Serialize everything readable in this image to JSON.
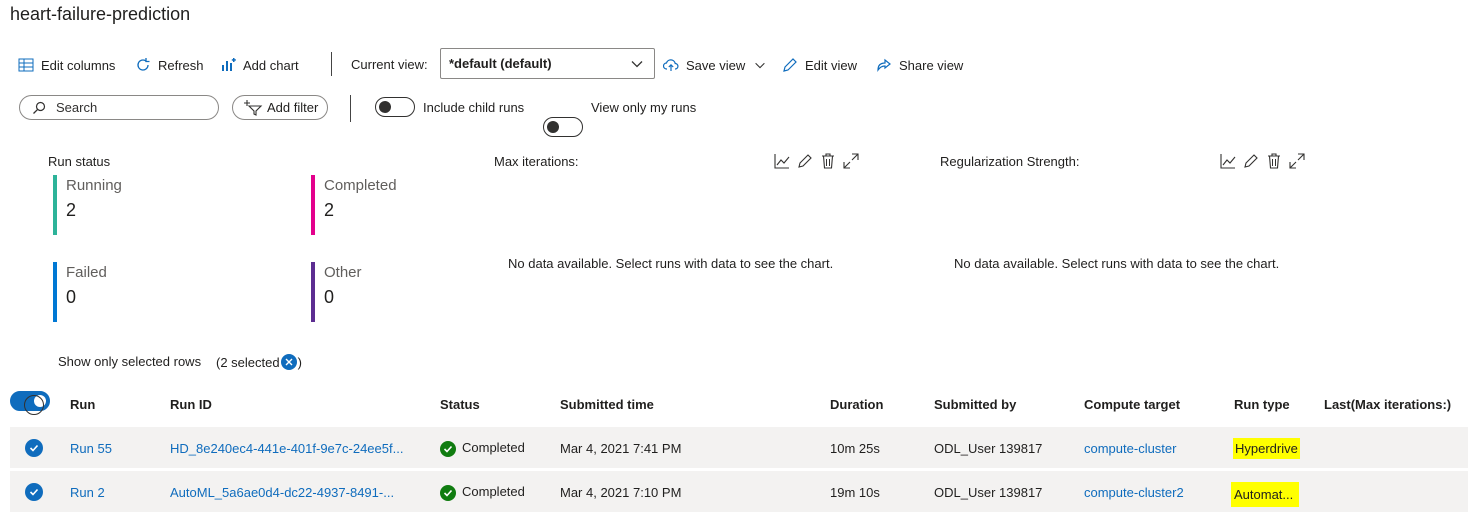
{
  "page": {
    "title": "heart-failure-prediction"
  },
  "toolbar": {
    "edit_columns": "Edit columns",
    "refresh": "Refresh",
    "add_chart": "Add chart",
    "current_view_label": "Current view:",
    "current_view_value": "*default (default)",
    "save_view": "Save view",
    "edit_view": "Edit view",
    "share_view": "Share view"
  },
  "filters": {
    "search_placeholder": "Search",
    "add_filter": "Add filter",
    "include_child_runs": "Include child runs",
    "view_only_my_runs": "View only my runs"
  },
  "run_status": {
    "title": "Run status",
    "tiles": [
      {
        "label": "Running",
        "count": "2",
        "color": "#2db399"
      },
      {
        "label": "Completed",
        "count": "2",
        "color": "#e3008c"
      },
      {
        "label": "Failed",
        "count": "0",
        "color": "#0078d4"
      },
      {
        "label": "Other",
        "count": "0",
        "color": "#5c2d91"
      }
    ]
  },
  "charts": [
    {
      "title": "Max iterations:",
      "message": "No data available. Select runs with data to see the chart."
    },
    {
      "title": "Regularization Strength:",
      "message": "No data available. Select runs with data to see the chart."
    }
  ],
  "selection": {
    "label": "Show only selected rows",
    "count_text": "(2 selected",
    "close_paren": ")"
  },
  "table": {
    "headers": [
      "Run",
      "Run ID",
      "Status",
      "Submitted time",
      "Duration",
      "Submitted by",
      "Compute target",
      "Run type",
      "Last(Max iterations:)"
    ],
    "rows": [
      {
        "run": "Run 55",
        "run_id": "HD_8e240ec4-441e-401f-9e7c-24ee5f...",
        "status": "Completed",
        "submitted_time": "Mar 4, 2021 7:41 PM",
        "duration": "10m 25s",
        "submitted_by": "ODL_User 139817",
        "compute_target": "compute-cluster",
        "run_type": "Hyperdrive"
      },
      {
        "run": "Run 2",
        "run_id": "AutoML_5a6ae0d4-dc22-4937-8491-...",
        "status": "Completed",
        "submitted_time": "Mar 4, 2021 7:10 PM",
        "duration": "19m 10s",
        "submitted_by": "ODL_User 139817",
        "compute_target": "compute-cluster2",
        "run_type": "Automat..."
      }
    ]
  },
  "colors": {
    "accent": "#0f6cbd",
    "success": "#107c10",
    "highlight": "#ffff00"
  }
}
